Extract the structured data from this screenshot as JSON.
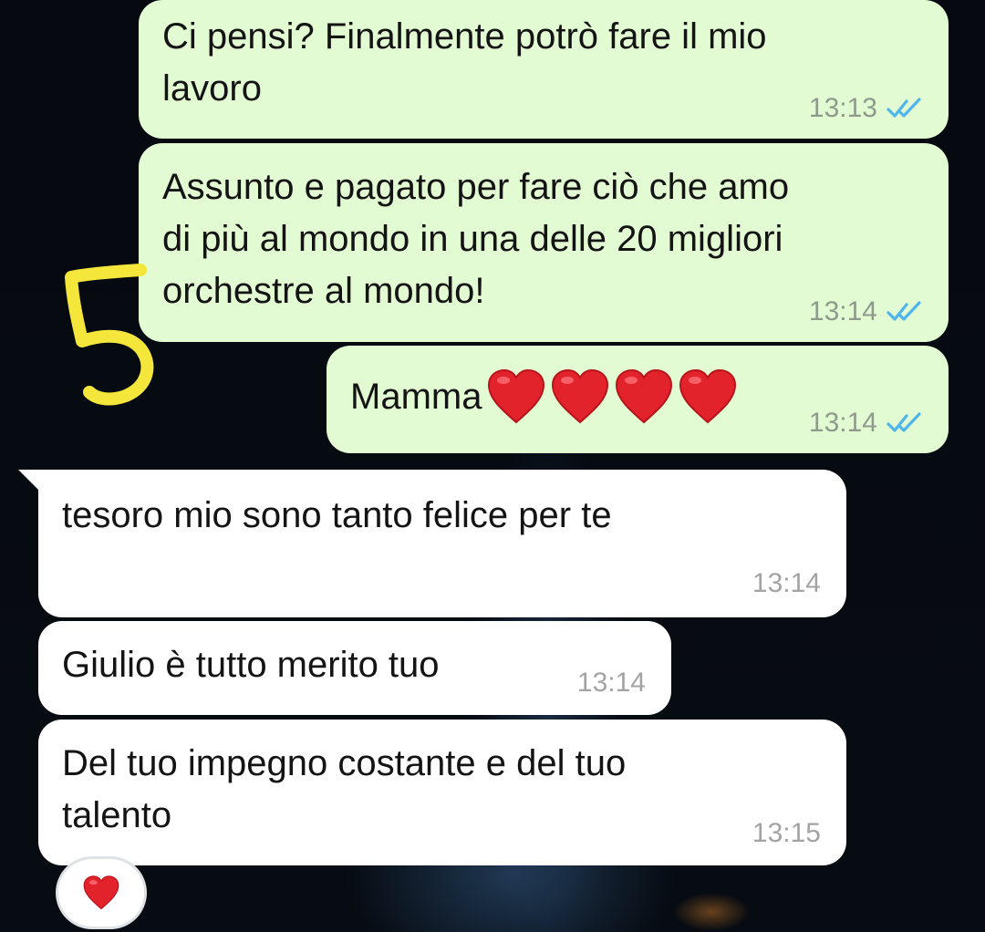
{
  "messages": [
    {
      "side": "out",
      "text": "Ci pensi? Finalmente potrò fare il mio\nlavoro",
      "time": "13:13",
      "status": "read"
    },
    {
      "side": "out",
      "text": "Assunto e pagato per fare ciò che amo\ndi più al mondo in una delle 20 migliori\norchestre al mondo!",
      "time": "13:14",
      "status": "read"
    },
    {
      "side": "out",
      "text": "Mamma",
      "emoji": [
        "red-heart",
        "red-heart",
        "red-heart",
        "red-heart"
      ],
      "time": "13:14",
      "status": "read"
    },
    {
      "side": "in",
      "text": "tesoro mio sono tanto felice per te",
      "time": "13:14"
    },
    {
      "side": "in",
      "text": "Giulio è tutto merito tuo",
      "time": "13:14"
    },
    {
      "side": "in",
      "text": "Del tuo impegno costante e del tuo\ntalento",
      "time": "13:15"
    }
  ],
  "reaction": {
    "emoji": "red-heart"
  },
  "annotation": {
    "text": "5",
    "color": "#f4e63a"
  },
  "colors": {
    "outgoing_bubble": "#e3fbd3",
    "incoming_bubble": "#ffffff",
    "read_ticks": "#4fb6ec",
    "heart": "#e3232c"
  }
}
